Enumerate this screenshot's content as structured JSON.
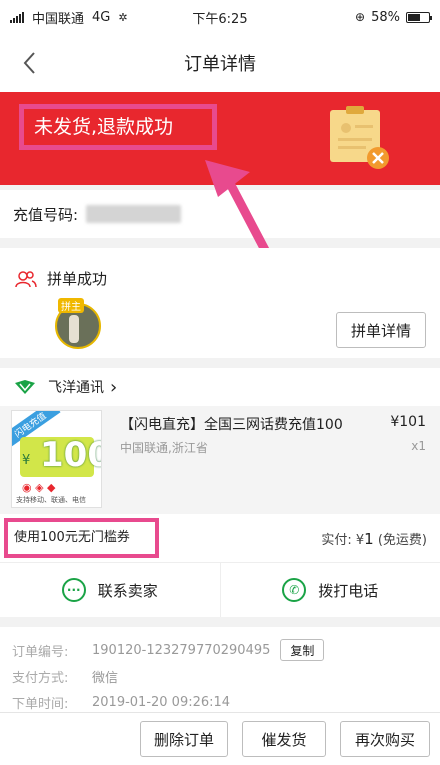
{
  "status": {
    "carrier": "中国联通",
    "network": "4G",
    "time": "下午6:25",
    "battery": "58%",
    "battery_level": 0.58
  },
  "nav": {
    "title": "订单详情"
  },
  "banner": {
    "status_text": "未发货,退款成功"
  },
  "recharge": {
    "label": "充值号码:"
  },
  "group": {
    "title": "拼单成功",
    "avatar_tag": "拼主",
    "detail_button": "拼单详情"
  },
  "shop": {
    "name": "飞洋通讯",
    "chevron": "›"
  },
  "product": {
    "title": "【闪电直充】全国三网话费充值100",
    "subtitle": "中国联通,浙江省",
    "price": "¥101",
    "quantity": "x1",
    "card_badge": "闪电充值",
    "card_amount": "100",
    "card_currency": "¥",
    "card_caption": "支持移动、联通、电信"
  },
  "coupon": {
    "text": "使用100元无门槛券"
  },
  "payment": {
    "label": "实付:",
    "currency": "¥",
    "amount": "1",
    "note": "(免运费)"
  },
  "actions": {
    "contact_seller": "联系卖家",
    "call_phone": "拨打电话"
  },
  "order_info": {
    "order_no_label": "订单编号:",
    "order_no": "190120-123279770290495",
    "copy_button": "复制",
    "pay_method_label": "支付方式:",
    "pay_method": "微信",
    "order_time_label": "下单时间:",
    "order_time": "2019-01-20 09:26:14"
  },
  "bottom_bar": {
    "delete": "删除订单",
    "urge": "催发货",
    "rebuy": "再次购买"
  },
  "colors": {
    "banner_red": "#e8272e",
    "highlight_pink": "#e84a8e",
    "green": "#1aa346"
  }
}
